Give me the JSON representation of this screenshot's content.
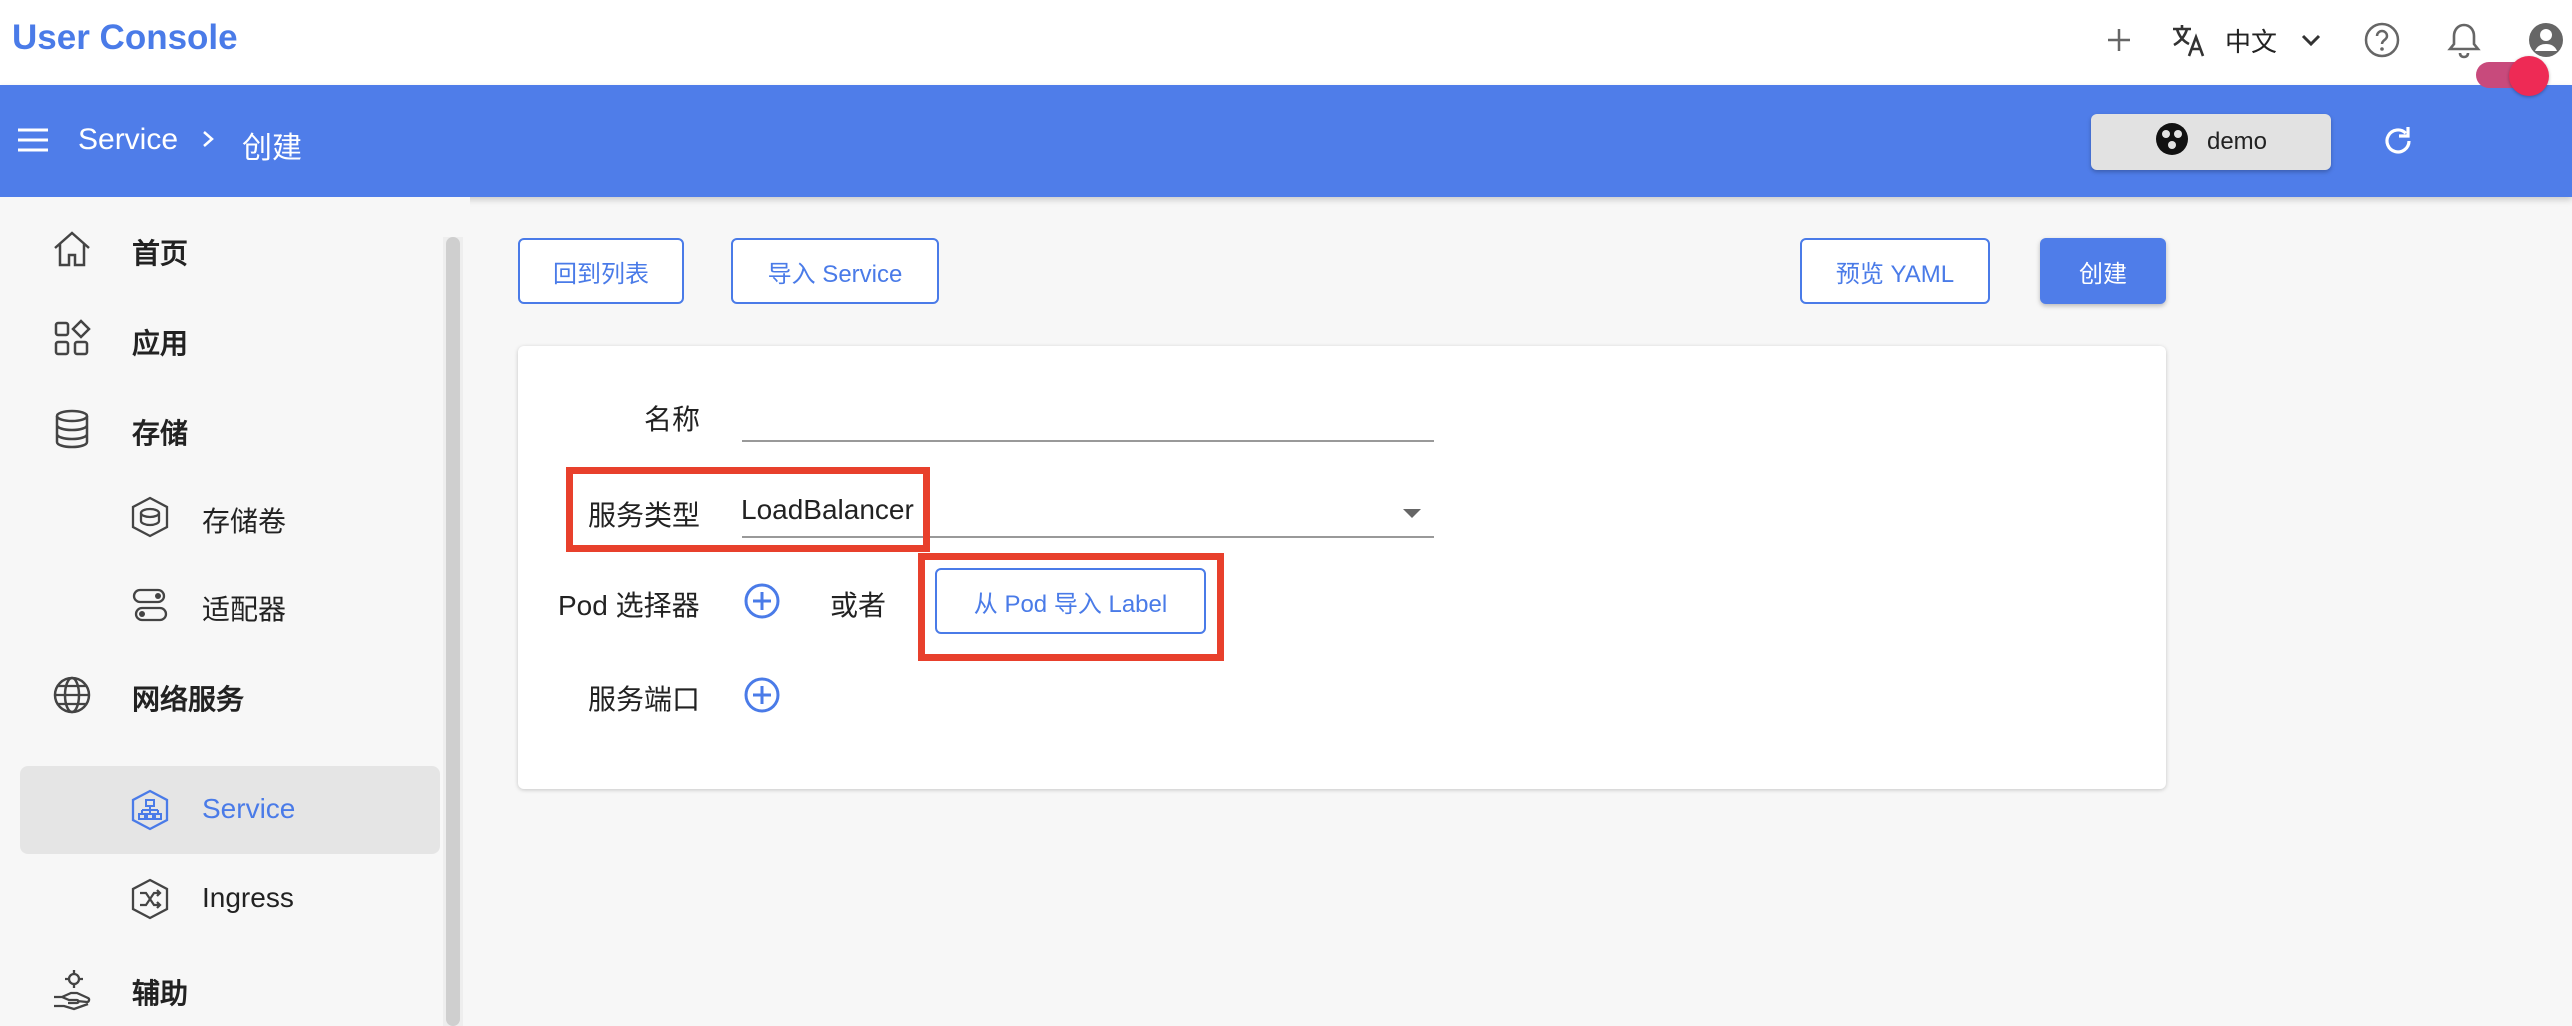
{
  "header": {
    "app_title": "User Console",
    "language": "中文",
    "icons": [
      "plus-icon",
      "translate-icon",
      "chevron-down-icon",
      "help-icon",
      "bell-icon",
      "account-icon"
    ]
  },
  "navbar": {
    "breadcrumb": [
      "Service",
      "创建"
    ],
    "namespace": "demo",
    "colors": {
      "bar": "#4f7de9",
      "toggle": "#ee2a55"
    }
  },
  "sidebar": {
    "items": [
      {
        "label": "首页",
        "icon": "home-icon",
        "level": 1
      },
      {
        "label": "应用",
        "icon": "apps-icon",
        "level": 1
      },
      {
        "label": "存储",
        "icon": "database-icon",
        "level": 1
      },
      {
        "label": "存储卷",
        "icon": "volume-icon",
        "level": 2
      },
      {
        "label": "适配器",
        "icon": "adapter-icon",
        "level": 2
      },
      {
        "label": "网络服务",
        "icon": "globe-icon",
        "level": 1
      },
      {
        "label": "Service",
        "icon": "service-icon",
        "level": 2,
        "active": true
      },
      {
        "label": "Ingress",
        "icon": "ingress-icon",
        "level": 2
      },
      {
        "label": "辅助",
        "icon": "helper-icon",
        "level": 1
      }
    ]
  },
  "toolbar": {
    "back_label": "回到列表",
    "import_label": "导入 Service",
    "preview_label": "预览 YAML",
    "create_label": "创建"
  },
  "form": {
    "name_label": "名称",
    "name_value": "",
    "type_label": "服务类型",
    "type_value": "LoadBalancer",
    "pod_selector_label": "Pod 选择器",
    "or_label": "或者",
    "import_label_button": "从 Pod 导入 Label",
    "port_label": "服务端口"
  },
  "theme": {
    "accent": "#4a7be8",
    "highlight": "#e8402c"
  }
}
